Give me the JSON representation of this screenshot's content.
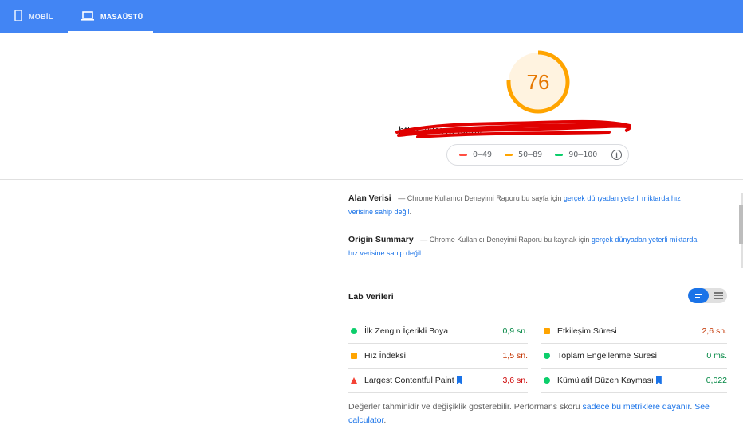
{
  "tabs": [
    {
      "label": "MOBİL",
      "icon": "phone-icon",
      "active": false
    },
    {
      "label": "MASAÜSTÜ",
      "icon": "laptop-icon",
      "active": true
    }
  ],
  "score": {
    "value": "76",
    "fraction": 0.76,
    "color": "#ffa400",
    "bg_color": "#fff3e0"
  },
  "url": {
    "text": "https://www.               .com/",
    "redacted": true
  },
  "legend": [
    {
      "range": "0–49",
      "color": "#ff4e42"
    },
    {
      "range": "50–89",
      "color": "#ffa400"
    },
    {
      "range": "90–100",
      "color": "#0cce6b"
    }
  ],
  "field_data": {
    "title": "Alan Verisi",
    "dash": "—",
    "text": "Chrome Kullanıcı Deneyimi Raporu bu sayfa için",
    "link": "gerçek dünyadan yeterli miktarda hız verisine sahip değil",
    "end": "."
  },
  "origin_summary": {
    "title": "Origin Summary",
    "dash": "—",
    "text": "Chrome Kullanıcı Deneyimi Raporu bu kaynak için",
    "link": "gerçek dünyadan yeterli miktarda hız verisine sahip değil",
    "end": "."
  },
  "lab": {
    "title": "Lab Verileri",
    "metrics_left": [
      {
        "label": "İlk Zengin İçerikli Boya",
        "value": "0,9 sn.",
        "status": "pass",
        "flag": false
      },
      {
        "label": "Hız İndeksi",
        "value": "1,5 sn.",
        "status": "average",
        "flag": false
      },
      {
        "label": "Largest Contentful Paint",
        "value": "3,6 sn.",
        "status": "fail",
        "flag": true
      }
    ],
    "metrics_right": [
      {
        "label": "Etkileşim Süresi",
        "value": "2,6 sn.",
        "status": "average",
        "flag": false
      },
      {
        "label": "Toplam Engellenme Süresi",
        "value": "0 ms.",
        "status": "pass",
        "flag": false
      },
      {
        "label": "Kümülatif Düzen Kayması",
        "value": "0,022",
        "status": "pass",
        "flag": true
      }
    ]
  },
  "status_colors": {
    "pass": "#0cce6b",
    "average": "#ffa400",
    "fail": "#ff4e42",
    "pass_text": "#018642",
    "average_text": "#c33300",
    "fail_text": "#cc0000"
  },
  "footer": {
    "text": "Değerler tahminidir ve değişiklik gösterebilir. Performans skoru",
    "link1": "sadece bu metriklere dayanır",
    "mid": ".",
    "link2": "See calculator",
    "end": "."
  }
}
